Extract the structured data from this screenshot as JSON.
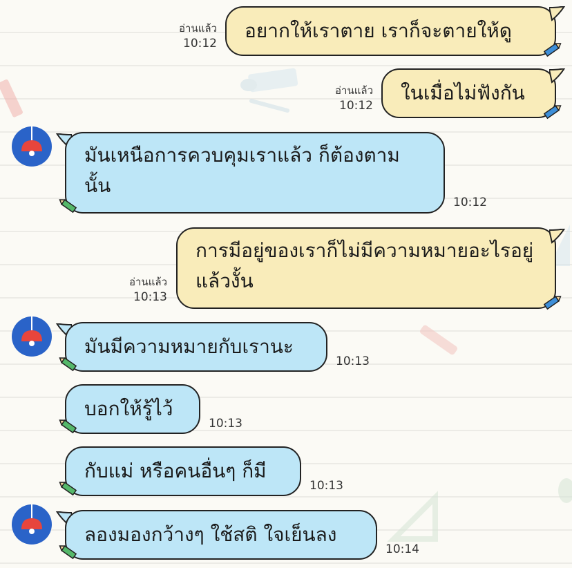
{
  "theme": {
    "outgoing_bubble": "#f9ecba",
    "incoming_bubble": "#bde6f7",
    "avatar_color": "#2a63c8",
    "lamp_color": "#e8453c"
  },
  "messages": [
    {
      "direction": "outgoing",
      "text": "อยากให้เราตาย เราก็จะตายให้ดู",
      "read": "อ่านแล้ว",
      "time": "10:12"
    },
    {
      "direction": "outgoing",
      "text": "ในเมื่อไม่ฟังกัน",
      "read": "อ่านแล้ว",
      "time": "10:12"
    },
    {
      "direction": "incoming",
      "text": "มันเหนือการควบคุมเราแล้ว ก็ต้องตามนั้น",
      "time": "10:12"
    },
    {
      "direction": "outgoing",
      "text": "การมีอยู่ของเราก็ไม่มีความหมายอะไรอยู่แล้วงั้น",
      "read": "อ่านแล้ว",
      "time": "10:13"
    },
    {
      "direction": "incoming",
      "text": "มันมีความหมายกับเรานะ",
      "time": "10:13"
    },
    {
      "direction": "incoming",
      "text": "บอกให้รู้ไว้",
      "time": "10:13"
    },
    {
      "direction": "incoming",
      "text": "กับแม่ หรือคนอื่นๆ ก็มี",
      "time": "10:13"
    },
    {
      "direction": "incoming",
      "text": "ลองมองกว้างๆ ใช้สติ ใจเย็นลง",
      "time": "10:14"
    }
  ]
}
